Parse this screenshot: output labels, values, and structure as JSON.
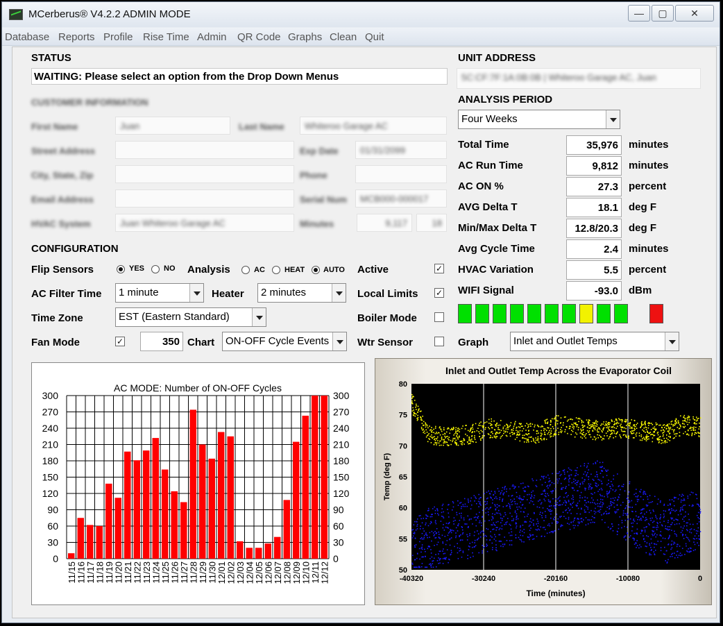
{
  "window": {
    "title": "MCerberus® V4.2.2 ADMIN MODE",
    "minimize": "—",
    "maximize": "▢",
    "close": "✕"
  },
  "menu": [
    "Database",
    "Reports",
    "Profile",
    "Rise Time",
    "Admin",
    "QR Code",
    "Graphs",
    "Clean",
    "Quit"
  ],
  "status": {
    "heading": "STATUS",
    "message": "WAITING: Please select an option from the Drop Down Menus"
  },
  "customer": {
    "heading": "CUSTOMER INFORMATION",
    "first_name_label": "First Name",
    "first_name": "Juan",
    "last_name_label": "Last Name",
    "last_name": "Whiteroo Garage AC",
    "street_label": "Street Address",
    "exp_date_label": "Exp Date",
    "exp_date": "01/31/2099",
    "city_label": "City, State, Zip",
    "phone_label": "Phone",
    "email_label": "Email Address",
    "serial_label": "Serial Num",
    "serial": "MCB000-000017",
    "hvac_label": "HVAC System",
    "hvac": "Juan Whiteroo Garage AC",
    "minutes_label": "Minutes",
    "minutes_value": "9,117",
    "minutes_extra": "18"
  },
  "configuration": {
    "heading": "CONFIGURATION",
    "flip_sensors_label": "Flip Sensors",
    "yes": "YES",
    "no": "NO",
    "analysis_label": "Analysis",
    "ac": "AC",
    "heat": "HEAT",
    "auto": "AUTO",
    "active_label": "Active",
    "ac_filter_label": "AC Filter Time",
    "ac_filter_value": "1 minute",
    "heater_label": "Heater",
    "heater_value": "2 minutes",
    "local_limits_label": "Local Limits",
    "time_zone_label": "Time Zone",
    "time_zone_value": "EST (Eastern Standard)",
    "boiler_mode_label": "Boiler Mode",
    "fan_mode_label": "Fan Mode",
    "fan_value": "350",
    "chart_label": "Chart",
    "chart_value": "ON-OFF Cycle Events",
    "wtr_sensor_label": "Wtr Sensor",
    "check_mark": "✓"
  },
  "unit": {
    "heading": "UNIT ADDRESS",
    "value": "5C:CF:7F:1A:0B:0B | Whiteroo Garage AC, Juan"
  },
  "analysis": {
    "heading": "ANALYSIS PERIOD",
    "period": "Four Weeks",
    "rows": [
      {
        "label": "Total Time",
        "value": "35,976",
        "unit": "minutes"
      },
      {
        "label": "AC Run Time",
        "value": "9,812",
        "unit": "minutes"
      },
      {
        "label": "AC ON %",
        "value": "27.3",
        "unit": "percent"
      },
      {
        "label": "AVG Delta T",
        "value": "18.1",
        "unit": "deg F"
      },
      {
        "label": "Min/Max Delta T",
        "value": "12.8/20.3",
        "unit": "deg F"
      },
      {
        "label": "Avg Cycle Time",
        "value": "2.4",
        "unit": "minutes"
      },
      {
        "label": "HVAC Variation",
        "value": "5.5",
        "unit": "percent"
      },
      {
        "label": "WIFI Signal",
        "value": "-93.0",
        "unit": "dBm"
      }
    ],
    "graph_label": "Graph",
    "graph_value": "Inlet and Outlet Temps"
  },
  "wifi_bars": [
    "#00e000",
    "#00e000",
    "#00e000",
    "#00e000",
    "#00e000",
    "#00e000",
    "#00e000",
    "#f2f200",
    "#00e000",
    "#00e000",
    "#ee1111"
  ],
  "colors": {
    "bar": "#ff0000",
    "inlet": "#ffff00",
    "outlet": "#1a1aff",
    "plot_bg": "#000000"
  },
  "chart_data": [
    {
      "type": "bar",
      "title": "AC MODE: Number of ON-OFF Cycles",
      "categories": [
        "11/15",
        "11/16",
        "11/17",
        "11/18",
        "11/19",
        "11/20",
        "11/21",
        "11/22",
        "11/23",
        "11/24",
        "11/25",
        "11/26",
        "11/27",
        "11/28",
        "11/29",
        "11/30",
        "12/01",
        "12/02",
        "12/03",
        "12/04",
        "12/05",
        "12/06",
        "12/07",
        "12/08",
        "12/09",
        "12/10",
        "12/11",
        "12/12"
      ],
      "values": [
        10,
        75,
        62,
        60,
        138,
        112,
        197,
        181,
        199,
        222,
        164,
        124,
        104,
        274,
        210,
        184,
        233,
        225,
        32,
        20,
        20,
        28,
        40,
        108,
        215,
        263,
        300,
        300
      ],
      "ylim": [
        0,
        300
      ],
      "yticks": [
        0,
        30,
        60,
        90,
        120,
        150,
        180,
        210,
        240,
        270,
        300
      ]
    },
    {
      "type": "scatter",
      "title": "Inlet and Outlet Temp Across the Evaporator Coil",
      "xlabel": "Time (minutes)",
      "ylabel": "Temp (deg F)",
      "xlim": [
        -40320,
        0
      ],
      "ylim": [
        50,
        80
      ],
      "xticks": [
        -40320,
        -30240,
        -20160,
        -10080,
        0
      ],
      "yticks": [
        50,
        55,
        60,
        65,
        70,
        75,
        80
      ],
      "series": [
        {
          "name": "Inlet",
          "x": [
            -40320,
            -38000,
            -35000,
            -32000,
            -29000,
            -26000,
            -23000,
            -20000,
            -17000,
            -14000,
            -11000,
            -8000,
            -5000,
            -2500,
            0
          ],
          "y": [
            77,
            72,
            71.5,
            72,
            73,
            72.5,
            72,
            73.5,
            73,
            72.5,
            73,
            72.5,
            72,
            73.5,
            73
          ]
        },
        {
          "name": "Outlet",
          "x": [
            -40320,
            -38000,
            -35000,
            -32000,
            -29000,
            -26000,
            -23000,
            -20000,
            -17000,
            -14000,
            -11000,
            -8000,
            -5000,
            -2500,
            0
          ],
          "y": [
            53,
            55,
            56,
            57,
            58,
            59,
            60,
            61,
            62,
            63,
            60,
            58,
            56,
            57.5,
            58
          ]
        }
      ]
    }
  ]
}
